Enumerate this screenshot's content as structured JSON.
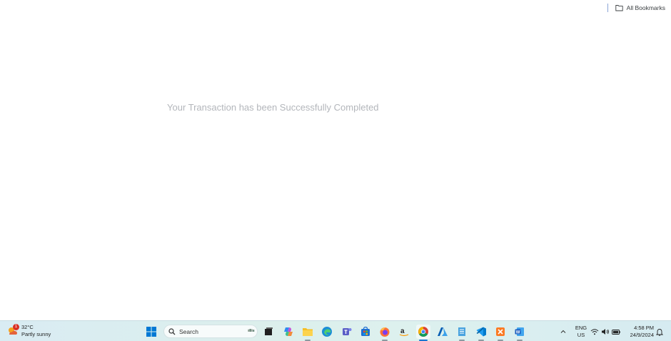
{
  "bookmarks_bar": {
    "all_bookmarks_label": "All Bookmarks"
  },
  "main": {
    "message": "Your Transaction has been Successfully Completed"
  },
  "taskbar": {
    "weather": {
      "temperature": "32°C",
      "condition": "Partly sunny",
      "badge_count": "1"
    },
    "search": {
      "label": "Search"
    },
    "apps": [
      "start-icon",
      "search-icon",
      "task-view-icon",
      "copilot-icon",
      "file-explorer-icon",
      "edge-icon",
      "teams-icon",
      "store-icon",
      "firefox-icon",
      "amazon-icon",
      "chrome-icon",
      "azure-icon",
      "notepad-icon",
      "vscode-icon",
      "xampp-icon",
      "word-icon"
    ],
    "tray": {
      "lang": "ENG",
      "region": "US",
      "time": "4:58 PM",
      "date": "24/9/2024"
    },
    "colors": {
      "taskbar_bg": "#dceeee",
      "active_indicator": "#1976d2",
      "windows_blue": "#0078d4"
    }
  }
}
